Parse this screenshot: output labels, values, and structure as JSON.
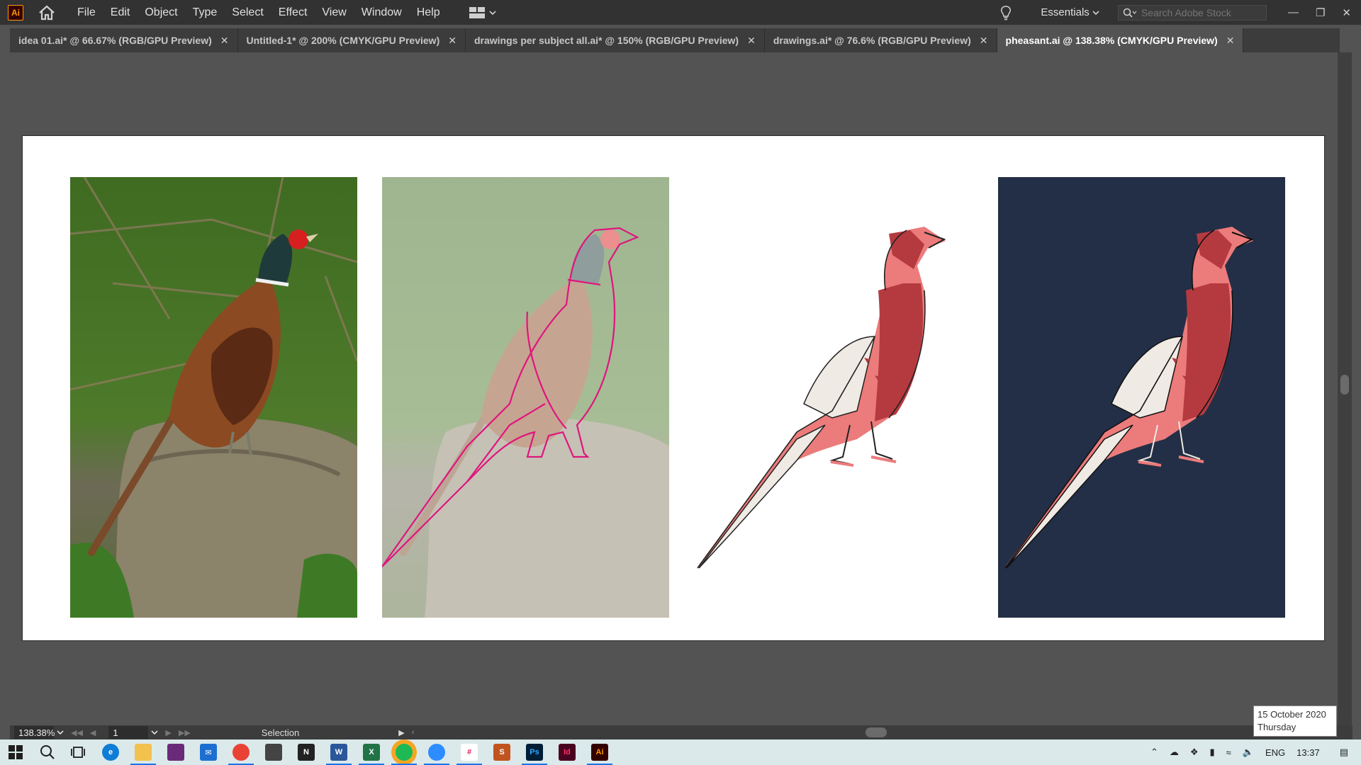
{
  "app": {
    "logo_text": "Ai"
  },
  "menubar": {
    "items": [
      "File",
      "Edit",
      "Object",
      "Type",
      "Select",
      "Effect",
      "View",
      "Window",
      "Help"
    ],
    "workspace": "Essentials",
    "search_placeholder": "Search Adobe Stock"
  },
  "tabs": [
    {
      "label": "idea 01.ai* @ 66.67% (RGB/GPU Preview)"
    },
    {
      "label": "Untitled-1* @ 200% (CMYK/GPU Preview)"
    },
    {
      "label": "drawings per subject all.ai* @ 150% (RGB/GPU Preview)"
    },
    {
      "label": "drawings.ai* @ 76.6% (RGB/GPU Preview)"
    },
    {
      "label": "pheasant.ai @ 138.38% (CMYK/GPU Preview)"
    }
  ],
  "status": {
    "zoom": "138.38%",
    "page": "1",
    "tool": "Selection"
  },
  "taskbar": {
    "language": "ENG",
    "time": "13:37",
    "tooltip_date": "15 October 2020",
    "tooltip_day": "Thursday"
  },
  "colors": {
    "accent_magenta": "#e0157e",
    "navy_bg": "#232f47",
    "pheasant_pink": "#ec7b7b",
    "pheasant_red": "#b53a3f",
    "pheasant_cream": "#efebe4"
  }
}
